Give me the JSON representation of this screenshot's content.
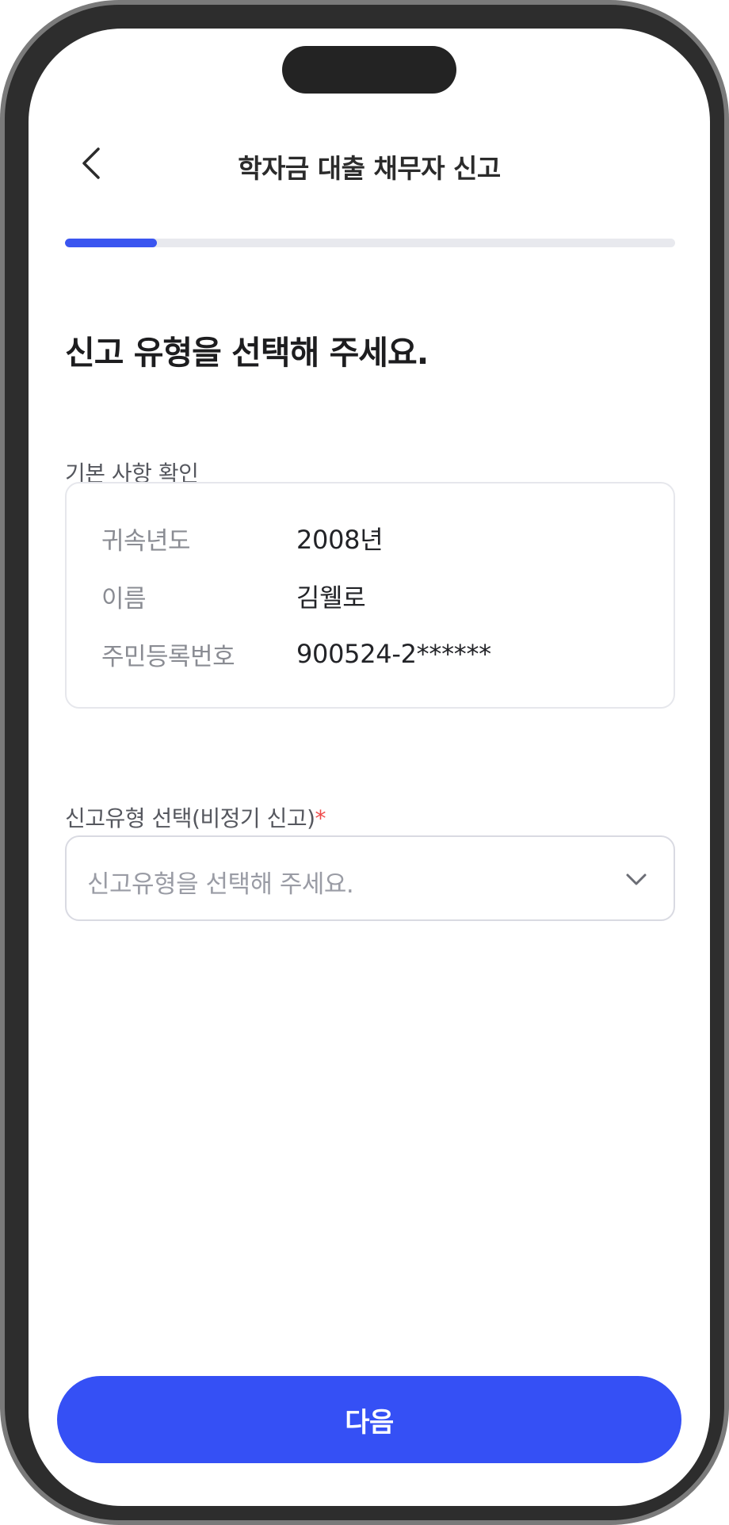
{
  "header": {
    "title": "학자금 대출 채무자 신고",
    "back_icon": "chevron-left-icon"
  },
  "progress": {
    "fraction": 0.15,
    "fill_color": "#3a55f0"
  },
  "main": {
    "heading": "신고 유형을 선택해 주세요.",
    "basic_info": {
      "label": "기본 사항 확인",
      "rows": [
        {
          "key": "귀속년도",
          "value": "2008년"
        },
        {
          "key": "이름",
          "value": "김웰로"
        },
        {
          "key": "주민등록번호",
          "value": "900524-2******"
        }
      ]
    },
    "report_type": {
      "label": "신고유형 선택(비정기 신고)",
      "required_mark": "*",
      "placeholder": "신고유형을 선택해 주세요.",
      "dropdown_icon": "chevron-down-icon"
    }
  },
  "footer": {
    "next_label": "다음",
    "button_color": "#3550f5"
  }
}
